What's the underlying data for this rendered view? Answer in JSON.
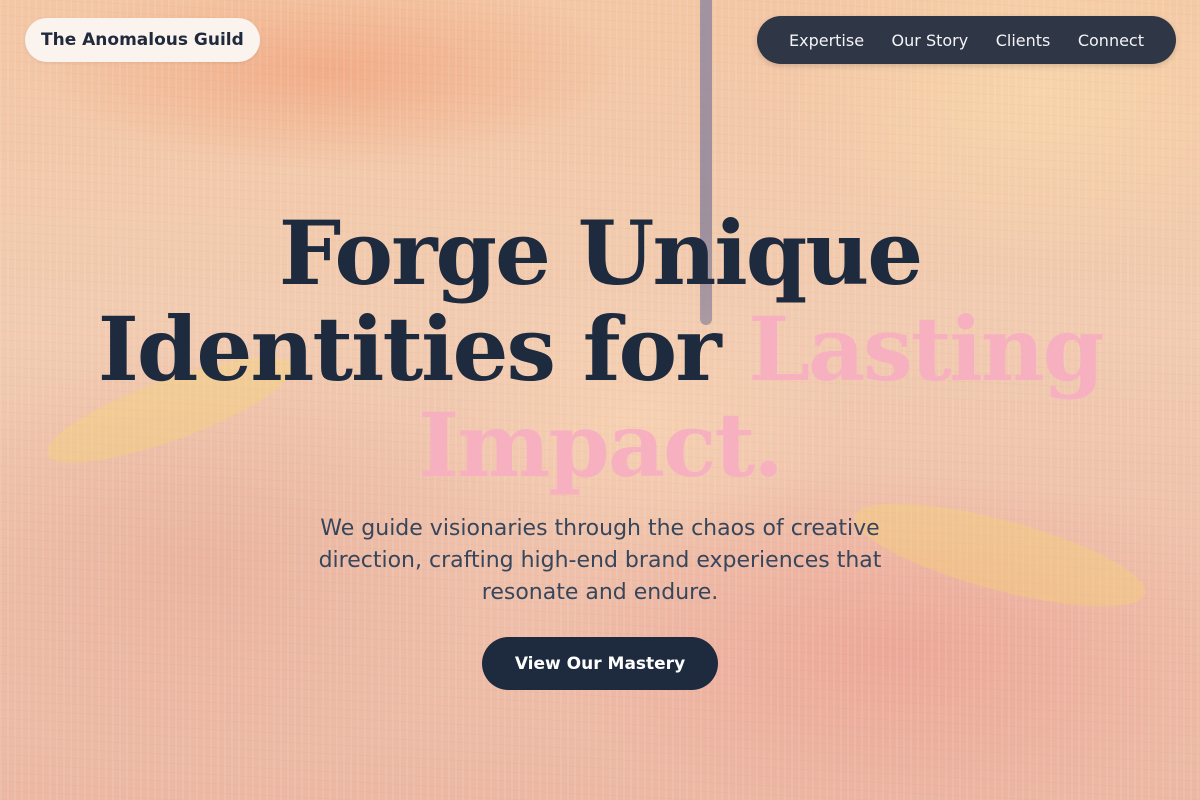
{
  "brand": {
    "name": "The Anomalous Guild"
  },
  "nav": {
    "items": [
      {
        "label": "Expertise"
      },
      {
        "label": "Our Story"
      },
      {
        "label": "Clients"
      },
      {
        "label": "Connect"
      }
    ]
  },
  "hero": {
    "headline_line1": "Forge Unique",
    "headline_line2_plain": "Identities for ",
    "headline_accent": "Lasting Impact.",
    "subtitle": "We guide visionaries through the chaos of creative direction, crafting high-end brand experiences that resonate and endure.",
    "cta_label": "View Our Mastery"
  },
  "colors": {
    "ink": "#1e2a3e",
    "accent_pink": "#f6b0c0",
    "nav_bg": "#2f3747",
    "brand_pill_bg": "#fbf3ee"
  }
}
